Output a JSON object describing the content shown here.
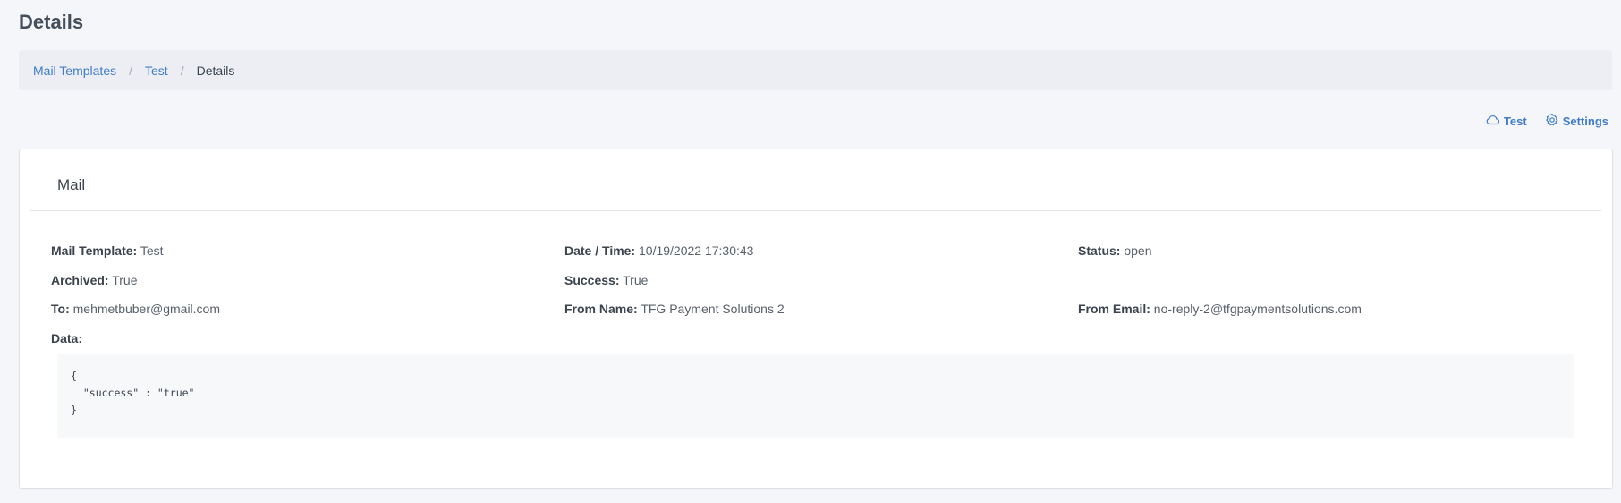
{
  "page": {
    "title": "Details"
  },
  "breadcrumb": {
    "items": [
      {
        "label": "Mail Templates"
      },
      {
        "label": "Test"
      },
      {
        "label": "Details"
      }
    ],
    "separator": "/"
  },
  "actions": {
    "test": {
      "label": "Test",
      "icon": "cloud-icon"
    },
    "settings": {
      "label": "Settings",
      "icon": "gear-icon"
    }
  },
  "card": {
    "title": "Mail",
    "fields": {
      "mail_template": {
        "label": "Mail Template:",
        "value": "Test"
      },
      "date_time": {
        "label": "Date / Time:",
        "value": "10/19/2022 17:30:43"
      },
      "status": {
        "label": "Status:",
        "value": "open"
      },
      "archived": {
        "label": "Archived:",
        "value": "True"
      },
      "success": {
        "label": "Success:",
        "value": "True"
      },
      "to": {
        "label": "To:",
        "value": "mehmetbuber@gmail.com"
      },
      "from_name": {
        "label": "From Name:",
        "value": "TFG Payment Solutions 2"
      },
      "from_email": {
        "label": "From Email:",
        "value": "no-reply-2@tfgpaymentsolutions.com"
      },
      "data": {
        "label": "Data:"
      }
    },
    "data_json": "{\n  \"success\" : \"true\"\n}"
  },
  "colors": {
    "link": "#3f7cc9",
    "background": "#f5f6fa",
    "breadcrumb_bg": "#eceef3"
  }
}
